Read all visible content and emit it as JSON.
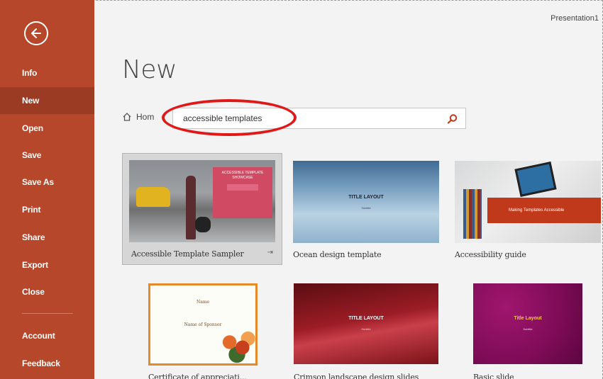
{
  "window": {
    "document_title": "Presentation1"
  },
  "sidebar": {
    "back_icon": "back-arrow-icon",
    "items": [
      {
        "label": "Info"
      },
      {
        "label": "New",
        "selected": true
      },
      {
        "label": "Open"
      },
      {
        "label": "Save"
      },
      {
        "label": "Save As"
      },
      {
        "label": "Print"
      },
      {
        "label": "Share"
      },
      {
        "label": "Export"
      },
      {
        "label": "Close"
      },
      {
        "label": "Account"
      },
      {
        "label": "Feedback"
      }
    ]
  },
  "main": {
    "page_title": "New",
    "home_label": "Hom",
    "search": {
      "value": "accessible templates",
      "icon": "search-icon"
    },
    "templates": [
      {
        "name": "Accessible Template Sampler",
        "thumb_title": "ACCESSIBLE TEMPLATE SHOWCASE",
        "selected": true
      },
      {
        "name": "Ocean design template",
        "thumb_title": "TITLE LAYOUT",
        "thumb_sub": "Subtitle"
      },
      {
        "name": "Accessibility guide",
        "thumb_title": "Making Templates Accessible"
      },
      {
        "name": "Certificate of appreciati...",
        "thumb_lines": [
          "Name",
          "Name of Sponsor"
        ]
      },
      {
        "name": "Crimson landscape design slides",
        "thumb_title": "TITLE LAYOUT",
        "thumb_sub": "Subtitle"
      },
      {
        "name": "Basic slide",
        "thumb_title": "Title Layout",
        "thumb_sub": "Subtitle"
      }
    ]
  },
  "colors": {
    "sidebar": "#b7472a",
    "sidebar_selected": "#9c3b23",
    "annotation": "#e01818",
    "search_icon": "#c0391b"
  }
}
